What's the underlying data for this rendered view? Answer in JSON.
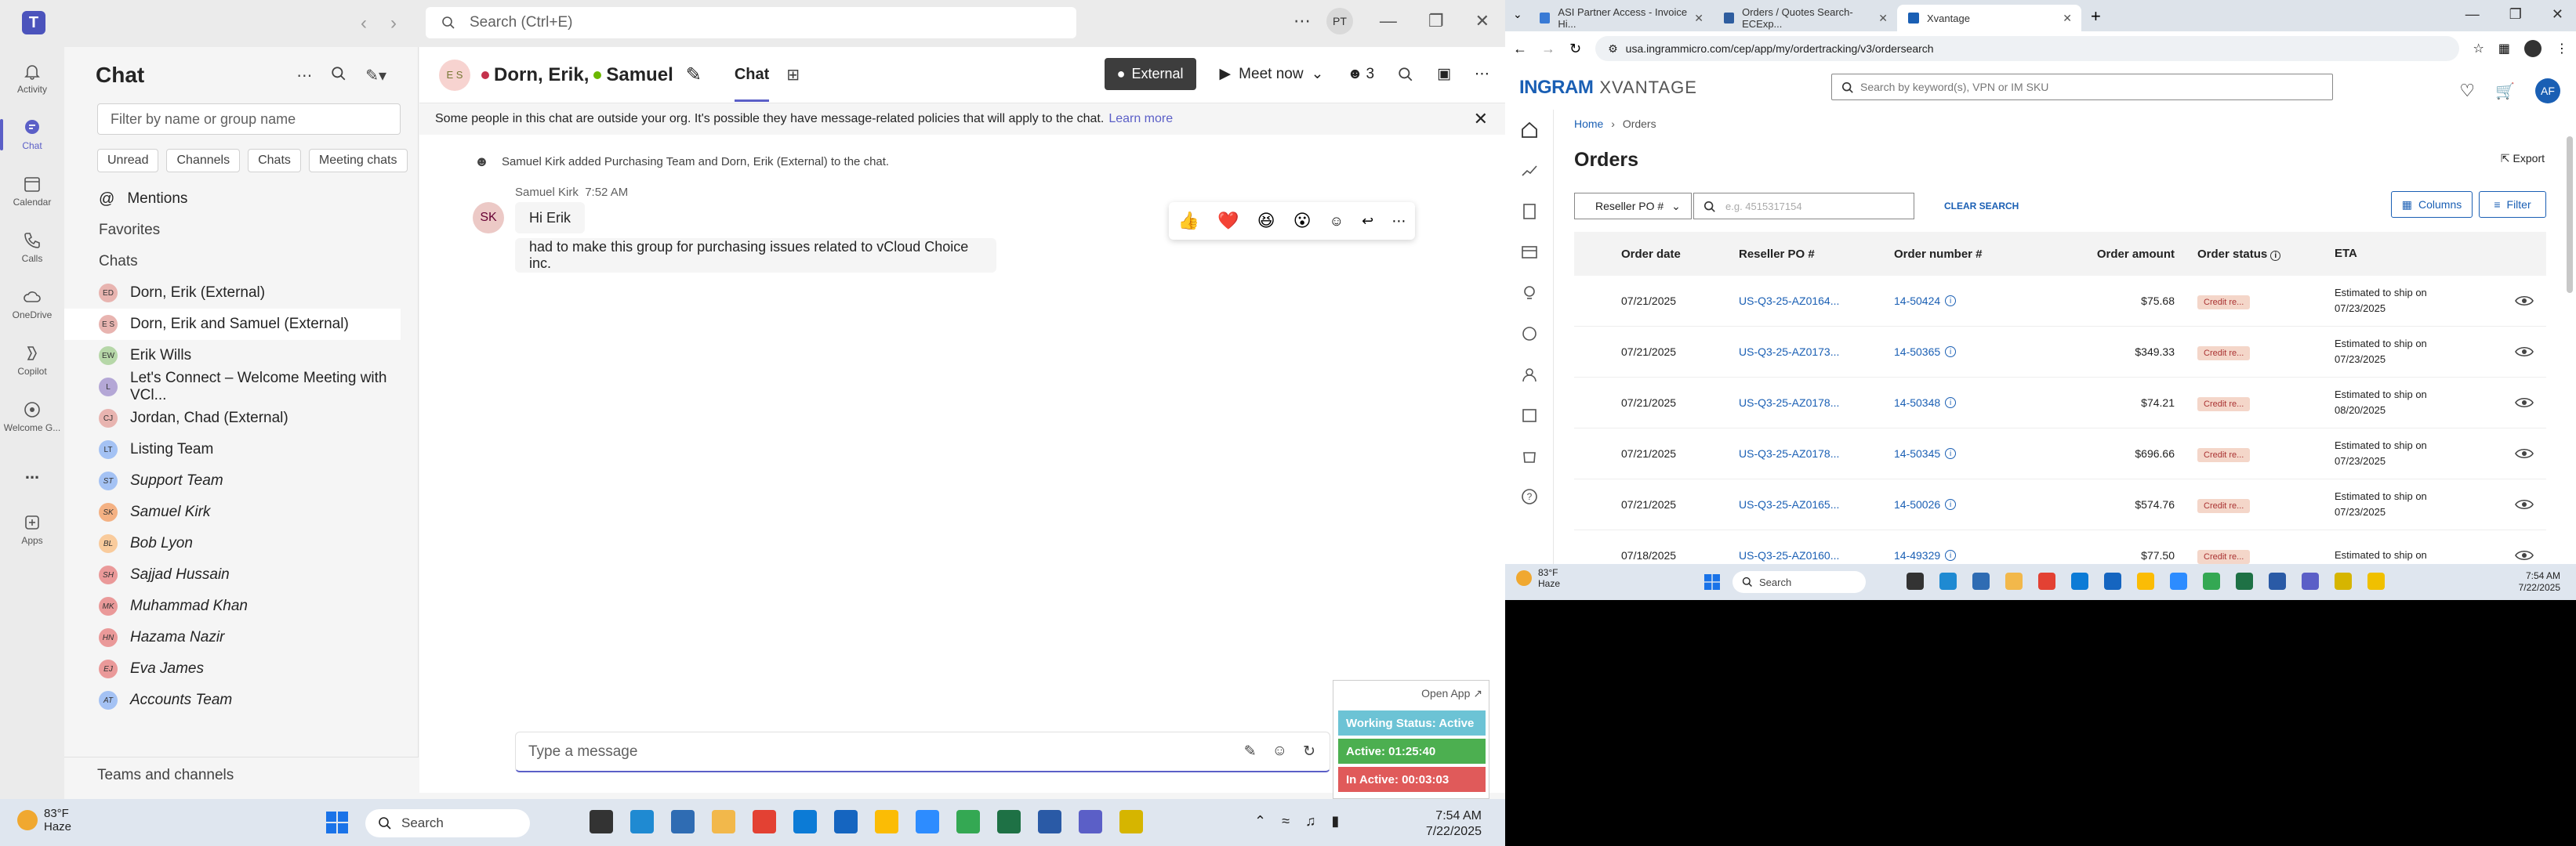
{
  "teams": {
    "search_placeholder": "Search (Ctrl+E)",
    "user_initials": "PT",
    "rail": [
      {
        "label": "Activity"
      },
      {
        "label": "Chat"
      },
      {
        "label": "Calendar"
      },
      {
        "label": "Calls"
      },
      {
        "label": "OneDrive"
      },
      {
        "label": "Copilot"
      },
      {
        "label": "Welcome G..."
      },
      {
        "label": "..."
      },
      {
        "label": "Apps"
      }
    ],
    "chat_title": "Chat",
    "filter_placeholder": "Filter by name or group name",
    "chips": [
      "Unread",
      "Channels",
      "Chats",
      "Meeting chats"
    ],
    "mentions": "Mentions",
    "favorites": "Favorites",
    "chats_section": "Chats",
    "chats": [
      {
        "initials": "ED",
        "name": "Dorn, Erik  (External)",
        "color": "#e8b4b0"
      },
      {
        "initials": "E S",
        "name": "Dorn, Erik and Samuel  (External)",
        "color": "#e8b4b0"
      },
      {
        "initials": "EW",
        "name": "Erik Wills",
        "color": "#b6d7a8"
      },
      {
        "initials": "L",
        "name": "Let's Connect – Welcome Meeting with VCl...",
        "color": "#b4a7d6"
      },
      {
        "initials": "CJ",
        "name": "Jordan, Chad  (External)",
        "color": "#e8b4b0"
      },
      {
        "initials": "LT",
        "name": "Listing Team",
        "color": "#a4c2f4"
      },
      {
        "initials": "ST",
        "name": "Support Team",
        "color": "#a4c2f4"
      },
      {
        "initials": "SK",
        "name": "Samuel Kirk",
        "color": "#f4b183"
      },
      {
        "initials": "BL",
        "name": "Bob Lyon",
        "color": "#f9cb9c"
      },
      {
        "initials": "SH",
        "name": "Sajjad Hussain",
        "color": "#ea9999"
      },
      {
        "initials": "MK",
        "name": "Muhammad Khan",
        "color": "#ea9999"
      },
      {
        "initials": "HN",
        "name": "Hazama Nazir",
        "color": "#ea9999"
      },
      {
        "initials": "EJ",
        "name": "Eva James",
        "color": "#ea9999"
      },
      {
        "initials": "AT",
        "name": "Accounts Team",
        "color": "#a4c2f4"
      }
    ],
    "teams_and_channels": "Teams and channels",
    "conversation": {
      "avatar_initials": "E S",
      "title": "Dorn, Erik,",
      "title_second": "Samuel",
      "tab": "Chat",
      "external_label": "External",
      "meet_now": "Meet now",
      "participants_count": "3",
      "banner_text": "Some people in this chat are outside your org. It's possible they have message-related policies that will apply to the chat.",
      "banner_link": "Learn more",
      "system_message": "Samuel Kirk added Purchasing Team and Dorn, Erik (External) to the chat.",
      "sender": "Samuel Kirk",
      "time": "7:52 AM",
      "sender_initials": "SK",
      "messages": [
        "Hi Erik",
        "had to make this group for purchasing issues related to vCloud Choice inc."
      ],
      "reactions": [
        "👍",
        "❤️",
        "😆",
        "😮"
      ],
      "compose_placeholder": "Type a message"
    },
    "widget": {
      "open_app": "Open App ↗",
      "working_status": "Working Status: Active",
      "active": "Active: 01:25:40",
      "inactive": "In Active: 00:03:03",
      "status_color": "#6cc3d5",
      "active_color": "#4caf50",
      "inactive_color": "#e05a5a"
    }
  },
  "taskbar_left": {
    "weather_temp": "83°F",
    "weather_desc": "Haze",
    "search": "Search",
    "time": "7:54 AM",
    "date": "7/22/2025"
  },
  "chrome": {
    "tabs": [
      {
        "title": "ASI Partner Access - Invoice Hi..."
      },
      {
        "title": "Orders / Quotes Search- ECExp..."
      },
      {
        "title": "Xvantage"
      }
    ],
    "url": "usa.ingrammicro.com/cep/app/my/ordertracking/v3/ordersearch",
    "brand": "INGRAM",
    "brand_sub": "XVANTAGE",
    "search_placeholder": "Search by keyword(s), VPN or IM SKU",
    "user_initials": "AF",
    "breadcrumb_home": "Home",
    "breadcrumb_current": "Orders",
    "page_title": "Orders",
    "export": "Export",
    "po_select": "Reseller PO #",
    "po_placeholder": "e.g. 4515317154",
    "clear_search": "CLEAR SEARCH",
    "columns_btn": "Columns",
    "filter_btn": "Filter",
    "headers": [
      "Order date",
      "Reseller PO #",
      "Order number #",
      "Order amount",
      "Order status",
      "ETA"
    ],
    "rows": [
      {
        "date": "07/21/2025",
        "po": "US-Q3-25-AZ0164...",
        "order": "14-50424",
        "amount": "$75.68",
        "status": "Credit re...",
        "eta1": "Estimated to ship on",
        "eta2": "07/23/2025"
      },
      {
        "date": "07/21/2025",
        "po": "US-Q3-25-AZ0173...",
        "order": "14-50365",
        "amount": "$349.33",
        "status": "Credit re...",
        "eta1": "Estimated to ship on",
        "eta2": "07/23/2025"
      },
      {
        "date": "07/21/2025",
        "po": "US-Q3-25-AZ0178...",
        "order": "14-50348",
        "amount": "$74.21",
        "status": "Credit re...",
        "eta1": "Estimated to ship on",
        "eta2": "08/20/2025"
      },
      {
        "date": "07/21/2025",
        "po": "US-Q3-25-AZ0178...",
        "order": "14-50345",
        "amount": "$696.66",
        "status": "Credit re...",
        "eta1": "Estimated to ship on",
        "eta2": "07/23/2025"
      },
      {
        "date": "07/21/2025",
        "po": "US-Q3-25-AZ0165...",
        "order": "14-50026",
        "amount": "$574.76",
        "status": "Credit re...",
        "eta1": "Estimated to ship on",
        "eta2": "07/23/2025"
      },
      {
        "date": "07/18/2025",
        "po": "US-Q3-25-AZ0160...",
        "order": "14-49329",
        "amount": "$77.50",
        "status": "Credit re...",
        "eta1": "Estimated to ship on",
        "eta2": ""
      }
    ]
  },
  "taskbar_right": {
    "weather_temp": "83°F",
    "weather_desc": "Haze",
    "search": "Search",
    "time": "7:54 AM",
    "date": "7/22/2025"
  }
}
